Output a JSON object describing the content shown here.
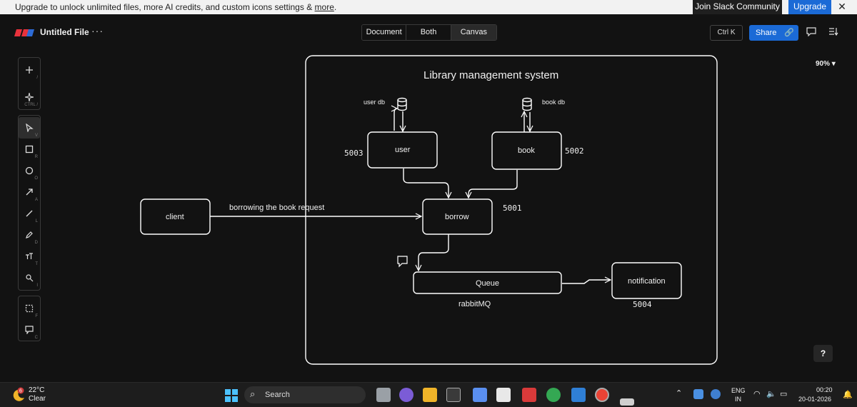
{
  "banner": {
    "message": "Upgrade to unlock unlimited files, more AI credits, and custom icons settings & ",
    "more_link": "more",
    "period": ".",
    "join_label": "Join Slack Community",
    "upgrade_label": "Upgrade",
    "close_icon": "close-icon"
  },
  "header": {
    "file_title": "Untitled File",
    "menu_dots": "···",
    "views": [
      "Document",
      "Both",
      "Canvas"
    ],
    "active_view": "Canvas",
    "shortcut_label": "Ctrl K",
    "share_label": "Share"
  },
  "toolbar": {
    "tools": [
      {
        "name": "add-icon",
        "key": "/"
      },
      {
        "name": "ai-sparkle-icon",
        "key": "CTRL /"
      },
      {
        "name": "select-pointer-icon",
        "key": "V",
        "active": true
      },
      {
        "name": "rectangle-icon",
        "key": "R"
      },
      {
        "name": "ellipse-icon",
        "key": "O"
      },
      {
        "name": "arrow-icon",
        "key": "A"
      },
      {
        "name": "line-icon",
        "key": "L"
      },
      {
        "name": "pencil-icon",
        "key": "D"
      },
      {
        "name": "text-icon",
        "key": "T"
      },
      {
        "name": "image-icon",
        "key": "I"
      },
      {
        "name": "frame-icon",
        "key": "F"
      },
      {
        "name": "comment-icon",
        "key": "C"
      }
    ]
  },
  "canvas": {
    "zoom": "90%",
    "help_label": "?",
    "frame_title": "Library management system",
    "nodes": {
      "client": "client",
      "user": "user",
      "book": "book",
      "borrow": "borrow",
      "queue": "Queue",
      "notification": "notification"
    },
    "labels": {
      "user_db": "user db",
      "book_db": "book db",
      "request": "borrowing the book request",
      "port_user": "5003",
      "port_book": "5002",
      "port_borrow": "5001",
      "port_notification": "5004",
      "rabbitmq": "rabbitMQ"
    }
  },
  "taskbar": {
    "weather_badge": "6",
    "temperature": "22°C",
    "condition": "Clear",
    "search_label": "Search",
    "lang_line1": "ENG",
    "lang_line2": "IN",
    "time": "00:20",
    "date": "20-01-2026"
  },
  "colors": {
    "accent": "#1b6ad6",
    "canvas_bg": "#121212",
    "stroke": "#ffffff"
  }
}
